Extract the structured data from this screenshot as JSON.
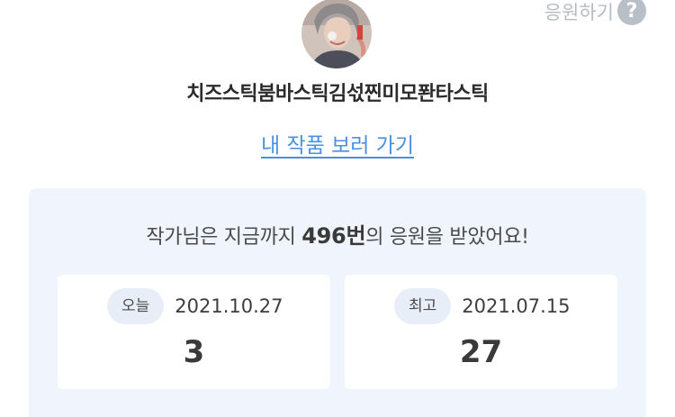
{
  "header": {
    "cheer_label": "응원하기",
    "help_symbol": "?"
  },
  "profile": {
    "author_name": "치즈스틱붐바스틱김섟찐미모퐌타스틱",
    "works_link": "내 작품 보러 가기"
  },
  "stats": {
    "summary_prefix": "작가님은 지금까지 ",
    "summary_count": "496번",
    "summary_suffix": "의 응원을 받았어요!",
    "today": {
      "badge": "오늘",
      "date": "2021.10.27",
      "value": "3"
    },
    "best": {
      "badge": "최고",
      "date": "2021.07.15",
      "value": "27"
    }
  },
  "colors": {
    "link": "#4a90e2",
    "panel_bg": "#f0f5fd",
    "badge_bg": "#e8eef8"
  }
}
